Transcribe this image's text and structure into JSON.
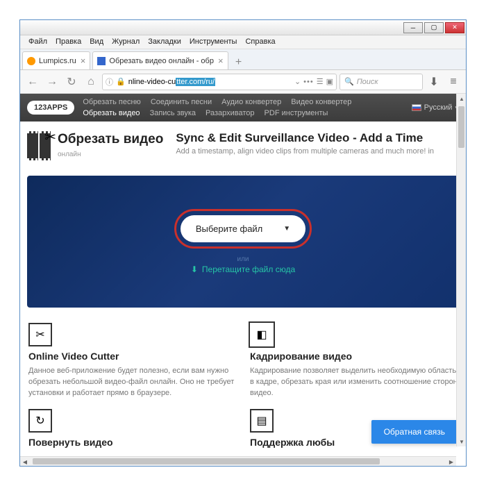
{
  "menubar": [
    "Файл",
    "Правка",
    "Вид",
    "Журнал",
    "Закладки",
    "Инструменты",
    "Справка"
  ],
  "tabs": [
    {
      "label": "Lumpics.ru"
    },
    {
      "label": "Обрезать видео онлайн - обр"
    }
  ],
  "url": {
    "pre": "nline-video-cu",
    "hl": "tter.com/ru/"
  },
  "search_placeholder": "Поиск",
  "site": {
    "logo": "123APPS",
    "links": [
      "Обрезать песню",
      "Соединить песни",
      "Аудио конвертер",
      "Видео конвертер",
      "Обрезать видео",
      "Запись звука",
      "Разархиватор",
      "PDF инструменты"
    ],
    "active_idx": 4,
    "lang": "Русский"
  },
  "app": {
    "title": "Обрезать видео",
    "sub": "онлайн"
  },
  "ad": {
    "title": "Sync & Edit Surveillance Video - Add a Time",
    "sub": "Add a timestamp, align video clips from multiple cameras and much more! in"
  },
  "upload": {
    "choose": "Выберите файл",
    "or": "или",
    "drag": "Перетащите файл сюда"
  },
  "features": [
    {
      "title": "Online Video Cutter",
      "desc": "Данное веб-приложение будет полезно, если вам нужно обрезать небольшой видео-файл онлайн. Оно не требует установки и работает прямо в браузере."
    },
    {
      "title": "Кадрирование видео",
      "desc": "Кадрирование позволяет выделить необходимую область в кадре, обрезать края или изменить соотношение сторон видео."
    }
  ],
  "features2": [
    {
      "title": "Повернуть видео"
    },
    {
      "title": "Поддержка любы"
    }
  ],
  "feedback": "Обратная связь"
}
